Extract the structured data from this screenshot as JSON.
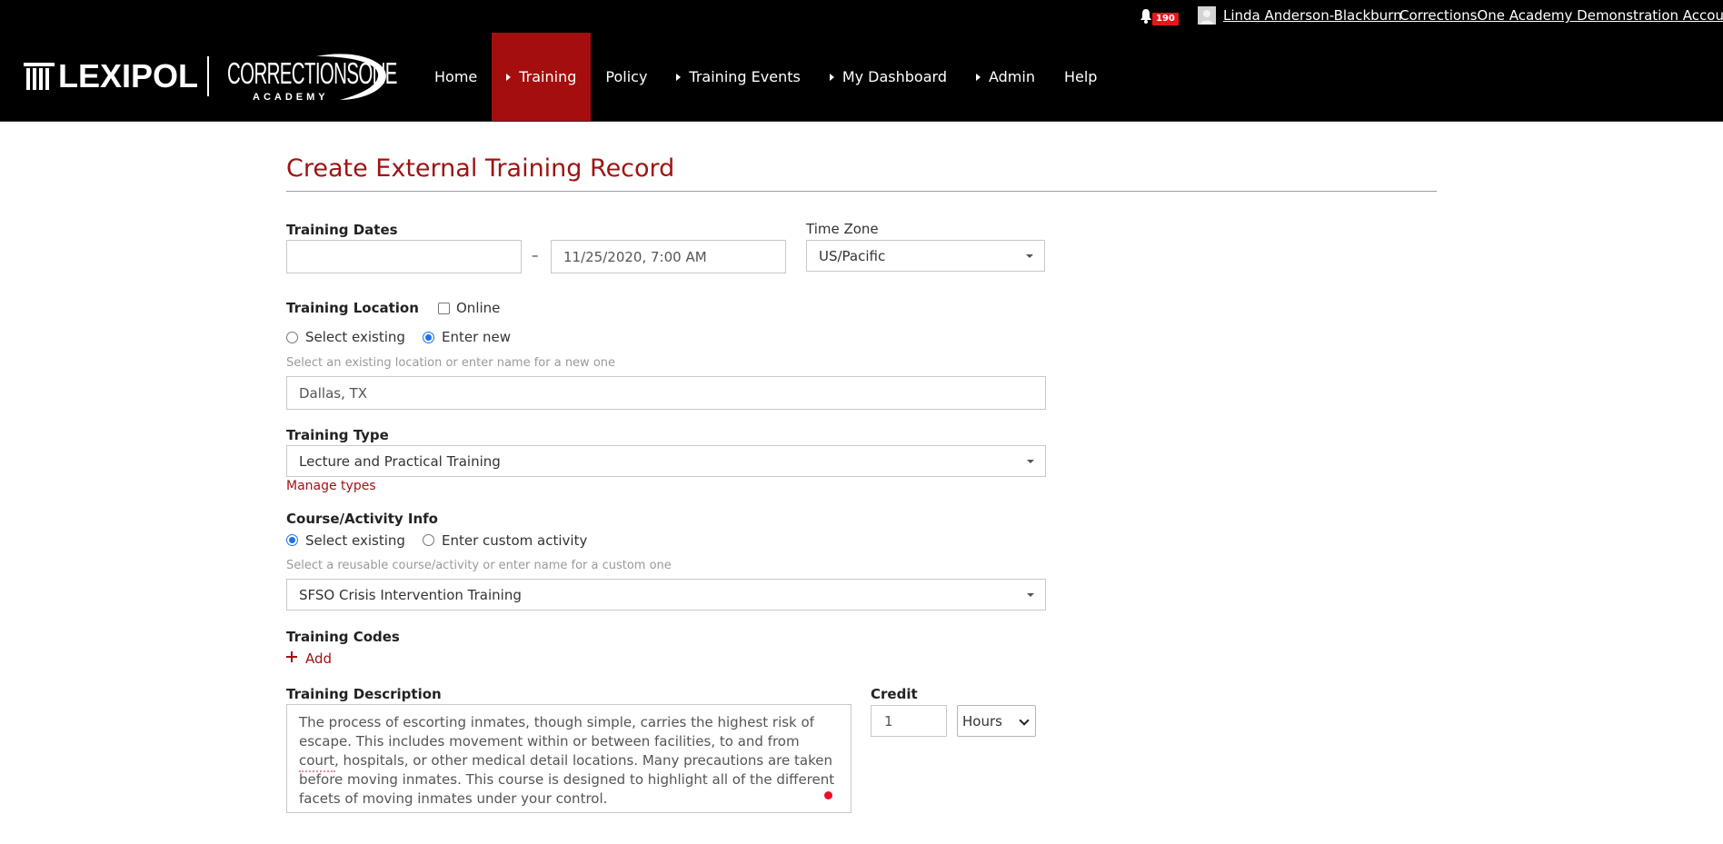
{
  "header": {
    "notification_count": "190",
    "user_name": "Linda Anderson-Blackburn",
    "account_name": "CorrectionsOne Academy Demonstration Account"
  },
  "logo": {
    "lexipol": "LEXIPOL",
    "corrections_one": "CORRECTIONSONE",
    "academy": "ACADEMY"
  },
  "nav": {
    "items": [
      {
        "label": "Home",
        "has_caret": false,
        "active": false
      },
      {
        "label": "Training",
        "has_caret": true,
        "active": true
      },
      {
        "label": "Policy",
        "has_caret": false,
        "active": false
      },
      {
        "label": "Training Events",
        "has_caret": true,
        "active": false
      },
      {
        "label": "My Dashboard",
        "has_caret": true,
        "active": false
      },
      {
        "label": "Admin",
        "has_caret": true,
        "active": false
      },
      {
        "label": "Help",
        "has_caret": false,
        "active": false
      }
    ]
  },
  "page": {
    "title": "Create External Training Record"
  },
  "form": {
    "training_dates": {
      "label": "Training Dates",
      "start_value": "",
      "separator": "–",
      "end_value": "11/25/2020, 7:00 AM"
    },
    "time_zone": {
      "label": "Time Zone",
      "value": "US/Pacific"
    },
    "location": {
      "label": "Training Location",
      "online_label": "Online",
      "online_checked": false,
      "option_existing": "Select existing",
      "option_new": "Enter new",
      "selected": "Enter new",
      "hint": "Select an existing location or enter name for a new one",
      "value": "Dallas, TX"
    },
    "training_type": {
      "label": "Training Type",
      "value": "Lecture and Practical Training",
      "manage_link": "Manage types"
    },
    "course": {
      "label": "Course/Activity Info",
      "option_existing": "Select existing",
      "option_custom": "Enter custom activity",
      "selected": "Select existing",
      "hint": "Select a reusable course/activity or enter name for a custom one",
      "value": "SFSO Crisis Intervention Training"
    },
    "training_codes": {
      "label": "Training Codes",
      "add_label": "Add"
    },
    "description": {
      "label": "Training Description",
      "value": "The process of escorting inmates, though simple, carries the highest risk of escape. This includes movement within or between facilities, to and from court, hospitals, or other medical detail locations. Many precautions are taken before moving inmates. This course is designed to highlight all of the different facets of moving inmates under your control."
    },
    "credit": {
      "label": "Credit",
      "value": "1",
      "unit": "Hours"
    }
  },
  "colors": {
    "brand_red": "#a01313",
    "nav_active": "#a50e0e",
    "badge_red": "#e8141c",
    "radio_blue": "#1a73e8"
  }
}
